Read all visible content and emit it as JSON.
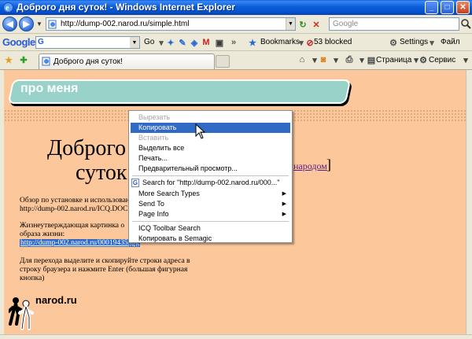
{
  "window": {
    "title": "Доброго дня суток! - Windows Internet Explorer"
  },
  "address": {
    "url": "http://dump-002.narod.ru/simple.html",
    "search_placeholder": "Google"
  },
  "google_toolbar": {
    "logo": "Google",
    "search_icon": "G",
    "go_label": "Go",
    "bookmarks_label": "Bookmarks",
    "blocked_label": "53 blocked",
    "settings_label": "Settings",
    "file_label": "Файл"
  },
  "tabs": {
    "active_label": "Доброго дня суток!"
  },
  "command_bar": {
    "page_label": "Страница",
    "service_label": "Сервис"
  },
  "page": {
    "banner": "про меня",
    "heading_line1": "Доброго",
    "heading_line2": "суток",
    "narod_link": "народом",
    "bracket": "]",
    "paragraph1_line1": "Обзор по установке и использовани",
    "paragraph1_line2": "http://dump-002.narod.ru/ICQ.DOC",
    "paragraph2_line1": "Жизнеутверждающая картинка о",
    "paragraph2_line2": "образа жизни:",
    "selected_link": "http://dump-002.narod.ru/00019435.jpg",
    "paragraph3_line1": "Для перехода выделите и скопируйте строки адреса в",
    "paragraph3_line2": "строку браузера и нажмите Enter (большая фигурная",
    "paragraph3_line3": "кнопка)",
    "logo_text": "narod.ru"
  },
  "context_menu": {
    "items": [
      {
        "label": "Вырезать",
        "disabled": true
      },
      {
        "label": "Копировать",
        "highlighted": true
      },
      {
        "label": "Вставить",
        "disabled": true
      },
      {
        "label": "Выделить все"
      },
      {
        "label": "Печать..."
      },
      {
        "label": "Предварительный просмотр..."
      },
      {
        "label": "Search for \"http://dump-002.narod.ru/000...\""
      },
      {
        "label": "More Search Types"
      },
      {
        "label": "Send To"
      },
      {
        "label": "Page Info"
      },
      {
        "label": "ICQ Toolbar Search"
      },
      {
        "label": "Копировать в Semagic"
      }
    ],
    "submenu_arrow": "▶"
  },
  "colors": {
    "page_background": "#fcc79a",
    "banner": "#99d2c9",
    "selection": "#316ac5",
    "titlebar": "#0551d3"
  }
}
